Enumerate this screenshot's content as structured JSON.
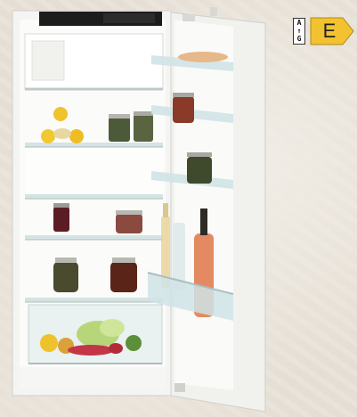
{
  "energy_label": {
    "scale_top": "A",
    "scale_arrow": "↑",
    "scale_bottom": "G",
    "energy_class": "E",
    "class_color": "#f2c230"
  },
  "colors": {
    "cabinet": "#f4f4f2",
    "control_panel": "#1c1c1c",
    "glass": "#cfe3e6"
  }
}
